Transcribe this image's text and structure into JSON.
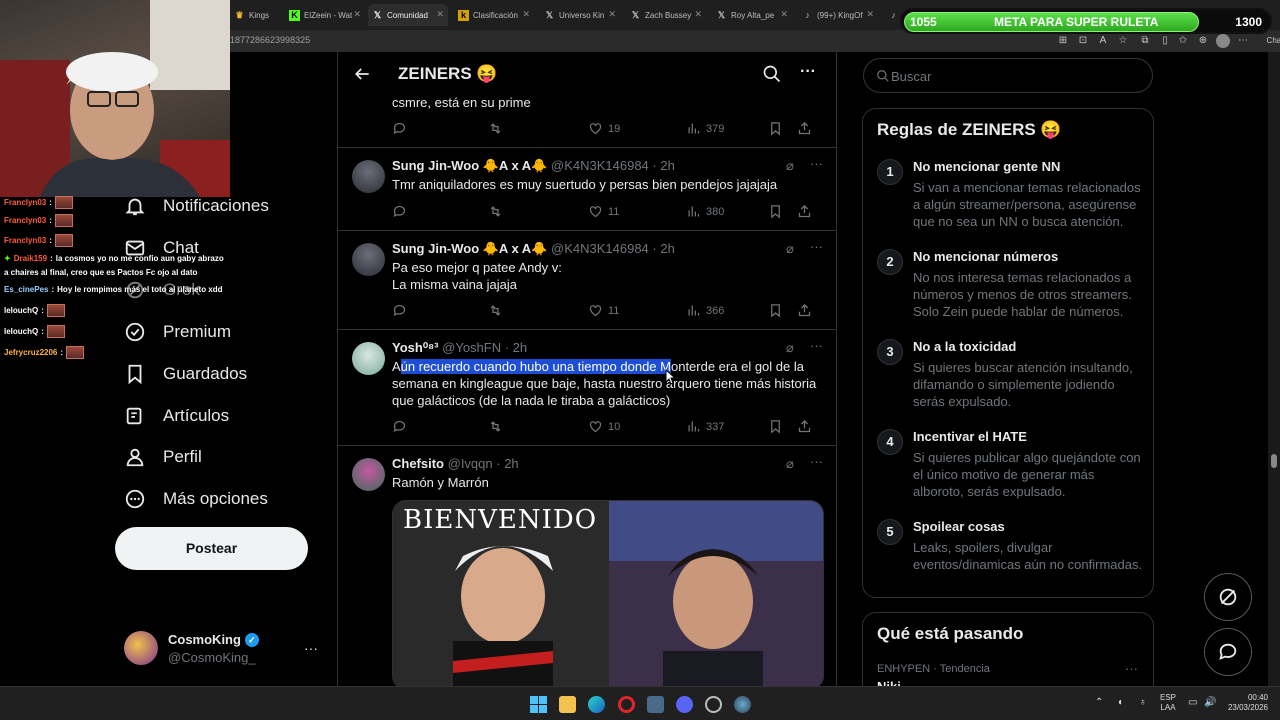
{
  "browser": {
    "tabs": [
      "Kings",
      "ElZeein - Wat",
      "Comunidad",
      "Clasificación",
      "Universo Kin",
      "Zach Bussey",
      "Roy Alta_pe",
      "(99+) KingOf",
      ""
    ],
    "url": "1877286623998325"
  },
  "meta": {
    "current": "1055",
    "title": "META PARA SUPER RULETA",
    "goal": "1300",
    "progress": 0.81
  },
  "chat": [
    {
      "user": "Franclyn03",
      "msg": ""
    },
    {
      "user": "Franclyn03",
      "msg": ""
    },
    {
      "user": "Franclyn03",
      "msg": ""
    },
    {
      "user": "Draik159",
      "msg": "la cosmos yo no me confio aun gaby abrazo"
    },
    {
      "user": "",
      "msg": "a chaires al final, creo que es Pactos Fc ojo al dato"
    },
    {
      "user": "Es_cinePes",
      "msg": "Hoy le rompimos más el toto al ulaneto xdd"
    },
    {
      "user": "lelouchQ",
      "msg": ""
    },
    {
      "user": "lelouchQ",
      "msg": ""
    },
    {
      "user": "Jefrycruz2206",
      "msg": ""
    }
  ],
  "nav": {
    "items": [
      "Notificaciones",
      "Chat",
      "Grok",
      "Premium",
      "Guardados",
      "Artículos",
      "Perfil",
      "Más opciones"
    ],
    "post_button": "Postear",
    "account": {
      "name": "CosmoKing",
      "handle": "@CosmoKing_"
    }
  },
  "feed": {
    "title": "ZEINERS 😝",
    "tweets": [
      {
        "name": "",
        "handle": "",
        "time": "",
        "text": "csmre, está en su prime",
        "replies": "",
        "retweets": "",
        "likes": "19",
        "views": "379"
      },
      {
        "name": "Sung Jin-Woo 🐥A x A🐥",
        "handle": "@K4N3K146984",
        "time": "2h",
        "text": "Tmr aniquiladores es muy suertudo y persas bien pendejos jajajaja",
        "likes": "11",
        "views": "380"
      },
      {
        "name": "Sung Jin-Woo 🐥A x A🐥",
        "handle": "@K4N3K146984",
        "time": "2h",
        "text": "Pa eso mejor q patee Andy v:\nLa misma vaina jajaja",
        "likes": "11",
        "views": "366"
      },
      {
        "name": "Yosh⁰⁸³",
        "handle": "@YoshFN",
        "time": "2h",
        "text_pre": "A",
        "text_hl": "ún recuerdo cuando hubo una tiempo donde M",
        "text_post": "onterde era el gol de la semana en kingleague que baje, hasta nuestro arquero tiene más historia que galácticos (de la nada le tiraba a galácticos)",
        "likes": "10",
        "views": "337"
      },
      {
        "name": "Chefsito",
        "handle": "@Ivqqn",
        "time": "2h",
        "text": "Ramón y Marrón",
        "image_caption": "BIENVENIDO"
      }
    ]
  },
  "right": {
    "search_placeholder": "Buscar",
    "rules_title": "Reglas de ZEINERS 😝",
    "rules": [
      {
        "num": "1",
        "title": "No mencionar gente NN",
        "desc": "Si van a mencionar temas relacionados a algún streamer/persona, asegúrense que no sea un NN o busca atención."
      },
      {
        "num": "2",
        "title": "No mencionar números",
        "desc": "No nos interesa temas relacionados a números y menos de otros streamers. Solo Zein puede hablar de números."
      },
      {
        "num": "3",
        "title": "No a la toxicidad",
        "desc": "Si quieres buscar atención insultando, difamando o simplemente jodiendo serás expulsado."
      },
      {
        "num": "4",
        "title": "Incentivar el HATE",
        "desc": "Si quieres publicar algo quejándote con el único motivo de generar más alboroto, serás expulsado."
      },
      {
        "num": "5",
        "title": "Spoilear cosas",
        "desc": "Leaks, spoilers, divulgar eventos/dinamicas aún no confirmadas."
      }
    ],
    "trends_title": "Qué está pasando",
    "trend_meta": "ENHYPEN · Tendencia",
    "trend_name": "Niki"
  },
  "taskbar": {
    "lang": "ESP",
    "lang2": "LAA",
    "time": "00:40",
    "date": "23/03/2026"
  },
  "colors": {
    "accent": "#1d9bf0",
    "meta_green": "#3ec42c",
    "muted": "#71767b"
  }
}
